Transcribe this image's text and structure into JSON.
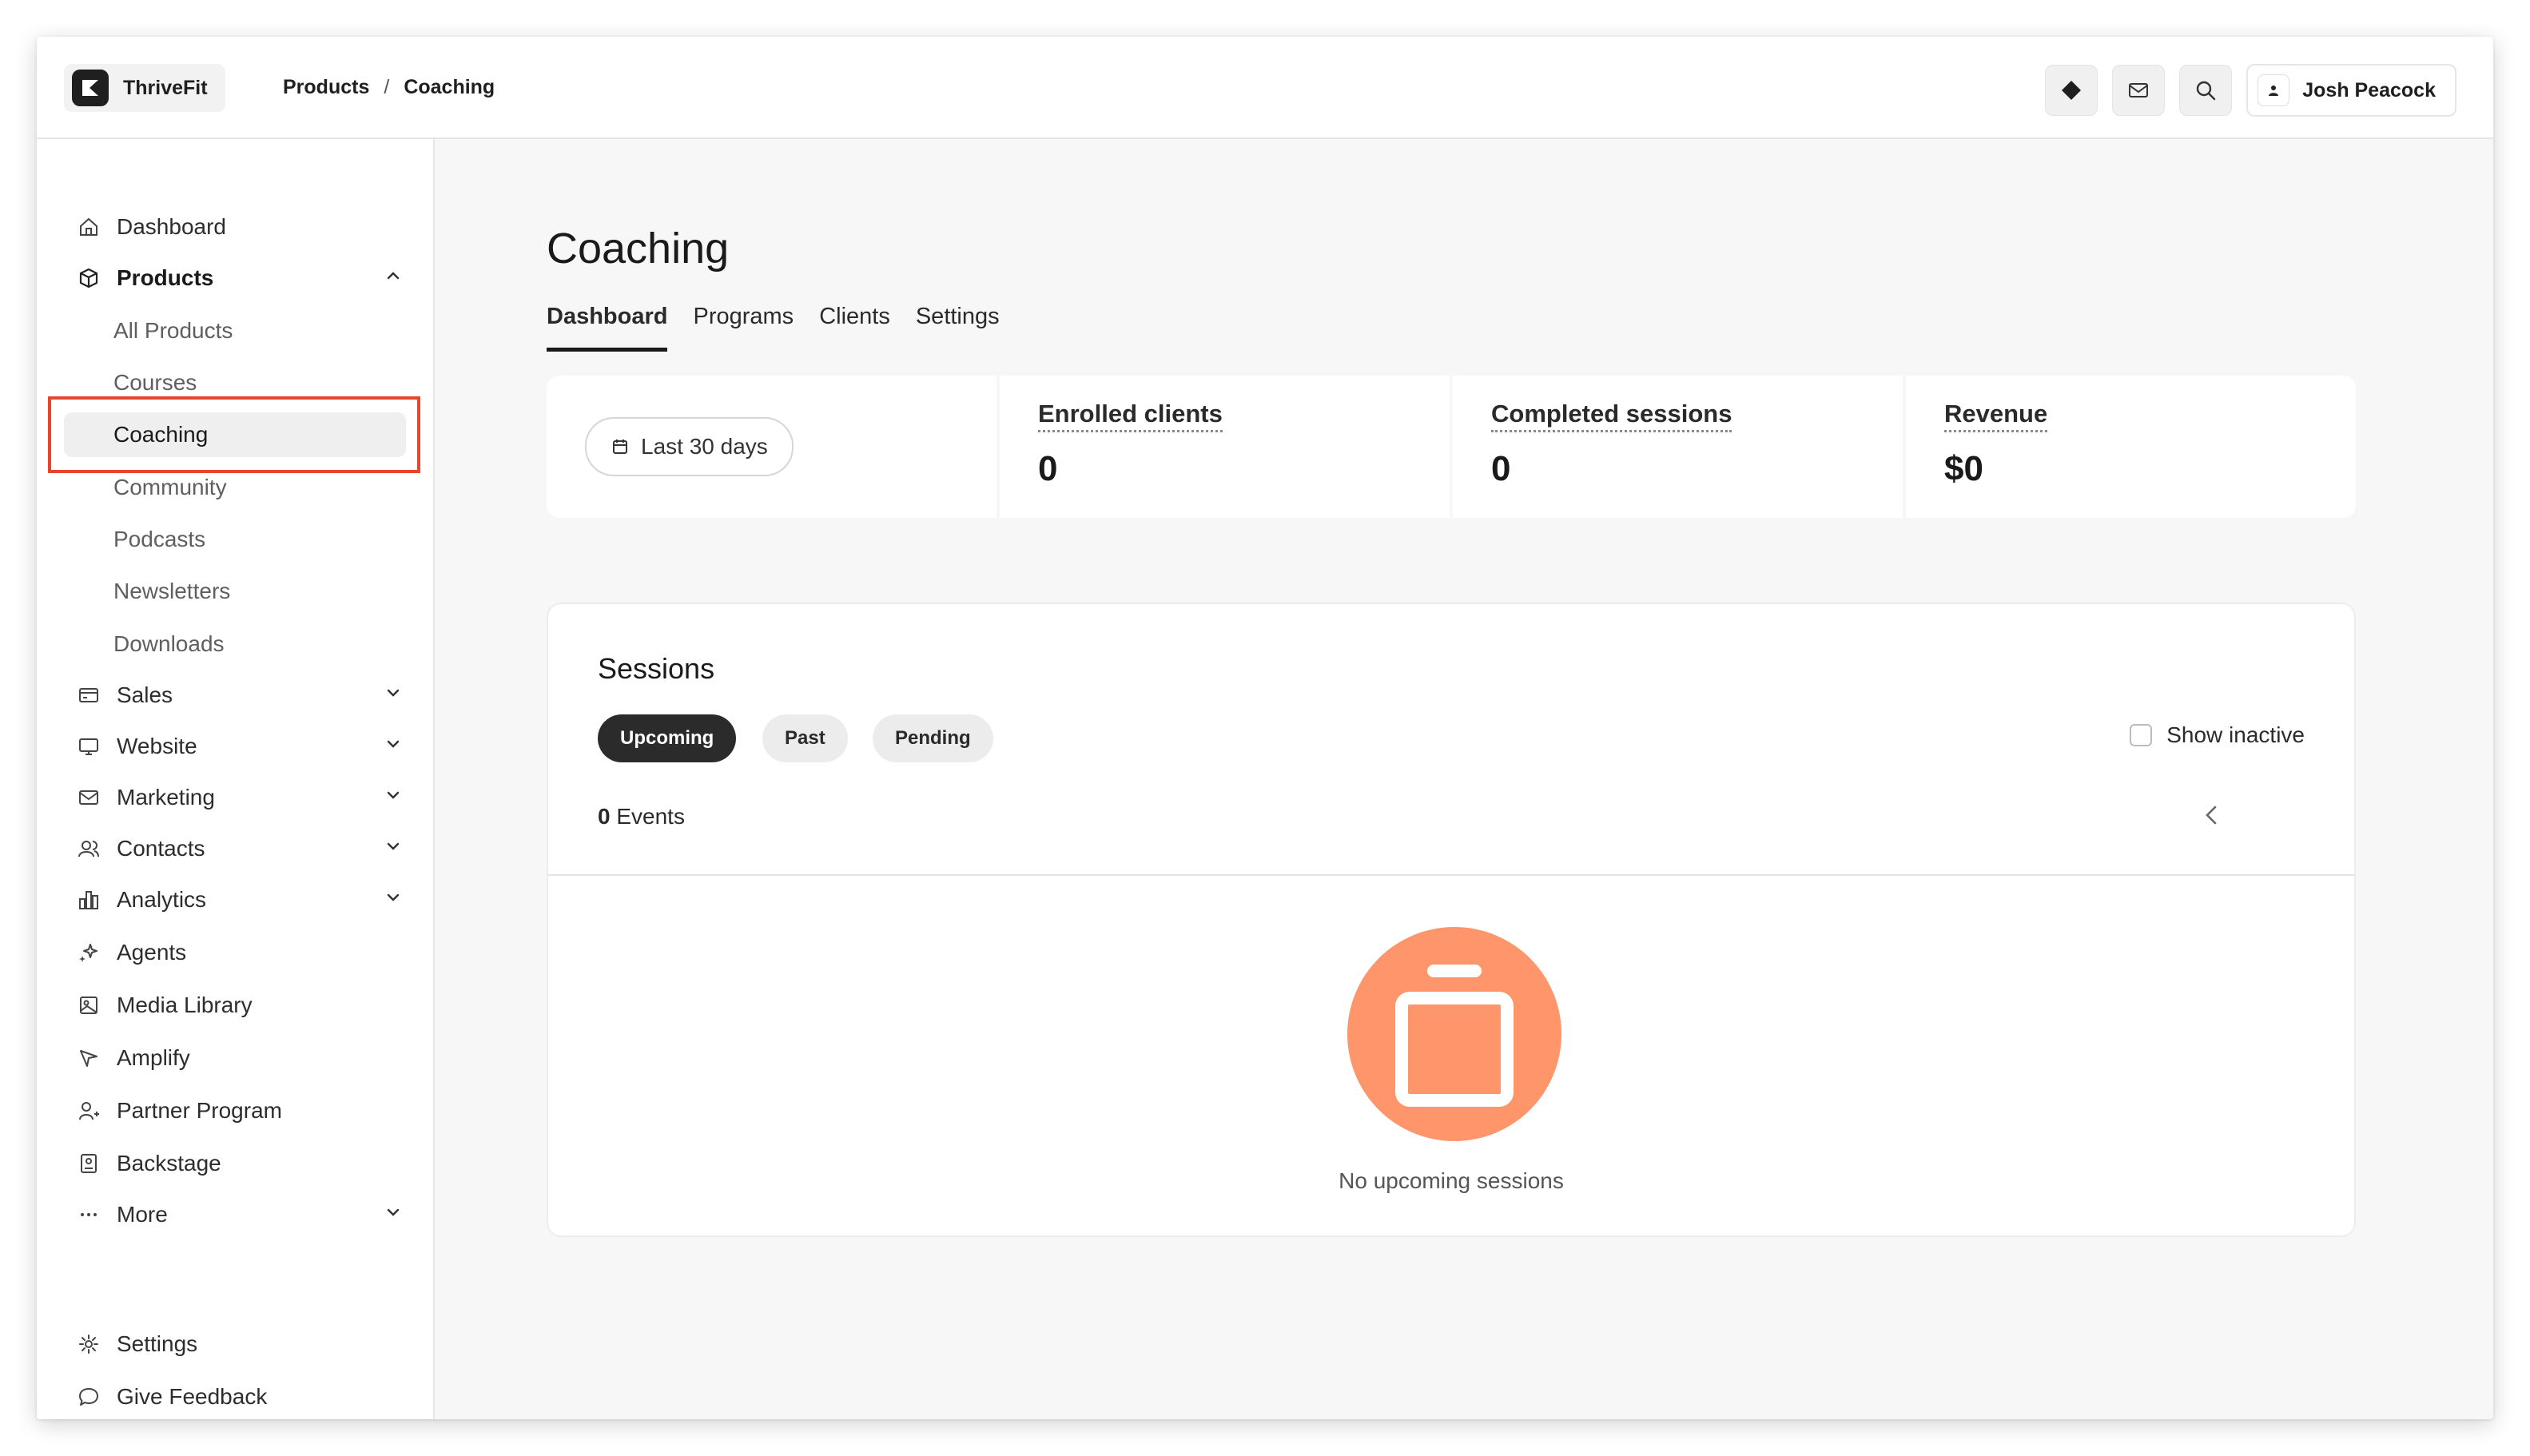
{
  "brand": {
    "name": "ThriveFit"
  },
  "breadcrumb": {
    "items": [
      "Products",
      "Coaching"
    ],
    "separator": "/"
  },
  "user": {
    "name": "Josh Peacock"
  },
  "sidebar": {
    "dashboard": "Dashboard",
    "products": "Products",
    "products_sub": [
      "All Products",
      "Courses",
      "Coaching",
      "Community",
      "Podcasts",
      "Newsletters",
      "Downloads"
    ],
    "sales": "Sales",
    "website": "Website",
    "marketing": "Marketing",
    "contacts": "Contacts",
    "analytics": "Analytics",
    "agents": "Agents",
    "media_library": "Media Library",
    "amplify": "Amplify",
    "partner_program": "Partner Program",
    "backstage": "Backstage",
    "more": "More",
    "settings": "Settings",
    "give_feedback": "Give Feedback"
  },
  "page": {
    "title": "Coaching",
    "tabs": [
      "Dashboard",
      "Programs",
      "Clients",
      "Settings"
    ]
  },
  "stats": {
    "range_label": "Last 30 days",
    "items": [
      {
        "label": "Enrolled clients",
        "value": "0"
      },
      {
        "label": "Completed sessions",
        "value": "0"
      },
      {
        "label": "Revenue",
        "value": "$0"
      }
    ]
  },
  "sessions": {
    "title": "Sessions",
    "filters": [
      "Upcoming",
      "Past",
      "Pending"
    ],
    "show_inactive": "Show inactive",
    "events_count": "0",
    "events_label": "Events",
    "empty_text": "No upcoming sessions"
  },
  "colors": {
    "accent": "#ff966b",
    "highlight_border": "#e8452e",
    "dark": "#2b2b2b"
  }
}
